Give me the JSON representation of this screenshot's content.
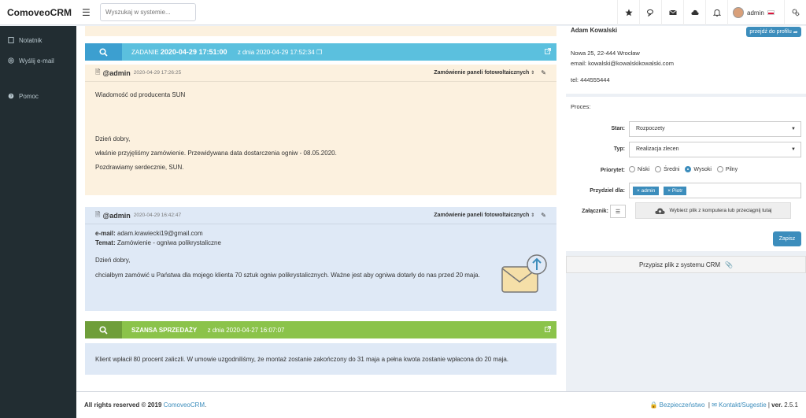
{
  "app": {
    "brand": "ComoveoCRM"
  },
  "search": {
    "placeholder": "Wyszukaj w systemie..."
  },
  "topbar": {
    "username": "admin"
  },
  "sidebar": {
    "items": [
      {
        "label": "Notatnik"
      },
      {
        "label": "Wyślij e-mail"
      },
      {
        "label": "Pomoc"
      }
    ]
  },
  "task": {
    "label": "ZADANIE",
    "datetime": "2020-04-29 17:51:00",
    "from_prefix": "z dnia",
    "from_date": "2020-04-29 17:52:34"
  },
  "message1": {
    "author": "@admin",
    "datetime": "2020-04-29 17:26:25",
    "category": "Zamówienie paneli fotowoltaicznych",
    "subject_line": "Wiadomość od producenta SUN",
    "lines": [
      "Dzień dobry,",
      "właśnie przyjęliśmy zamówienie. Przewidywana data dostarczenia ogniw - 08.05.2020.",
      "Pozdrawiamy serdecznie, SUN."
    ]
  },
  "message2": {
    "author": "@admin",
    "datetime": "2020-04-29 16:42:47",
    "category": "Zamówienie paneli fotowoltaicznych",
    "email_label": "e-mail:",
    "email_value": "adam.krawiecki19@gmail.com",
    "subject_label": "Temat:",
    "subject_value": "Zamówienie - ogniwa polikrystaliczne",
    "lines": [
      "Dzień dobry,",
      "chciałbym zamówić u Państwa dla mojego klienta 70 sztuk ogniw polikrystalicznych. Ważne jest aby ogniwa dotarły do nas przed 20 maja."
    ]
  },
  "opportunity": {
    "label": "SZANSA SPRZEDAŻY",
    "from_prefix": "z dnia",
    "from_date": "2020-04-27 16:07:07"
  },
  "note": {
    "text": "Klient wpłacił 80 procent zaliczli. W umowie uzgodniliśmy, że montaż zostanie zakończony do 31 maja a pełna kwota zostanie wpłacona do 20 maja."
  },
  "contact": {
    "name": "Adam Kowalski",
    "profile_button": "przejdź do profilu",
    "address": "Nowa 25, 22-444 Wrocław",
    "email": "email: kowalski@kowalskikowalski.com",
    "phone": "tel: 444555444"
  },
  "process": {
    "title": "Proces:",
    "stan_label": "Stan:",
    "stan_value": "Rozpoczety",
    "typ_label": "Typ:",
    "typ_value": "Realizacja zlecen",
    "priority_label": "Priorytet:",
    "priorities": [
      "Niski",
      "Średni",
      "Wysoki",
      "Pilny"
    ],
    "priority_selected": "Wysoki",
    "assign_label": "Przydziel dla:",
    "assignees": [
      "admin",
      "Piotr"
    ],
    "attach_label": "Załącznik:",
    "upload_text": "Wybierz plik z komputera  lub  przeciągnij tutaj",
    "save_button": "Zapisz",
    "assign_file_button": "Przypisz plik z systemu CRM"
  },
  "footer": {
    "rights": "All rights reserved © 2019",
    "brand_link": "ComoveoCRM",
    "security": "Bezpieczeństwo",
    "contact": "Kontakt/Sugestie",
    "version_label": "ver.",
    "version": "2.5.1"
  },
  "colors": {
    "sidebar": "#222d32",
    "task_bar": "#5bc0de",
    "task_icon": "#3c9fd0",
    "opp_bar": "#8bc34a",
    "opp_icon": "#6f9e3a",
    "note_bg": "#dfe9f6",
    "msg1_bg": "#fcf1df",
    "primary": "#3c8dbc"
  }
}
